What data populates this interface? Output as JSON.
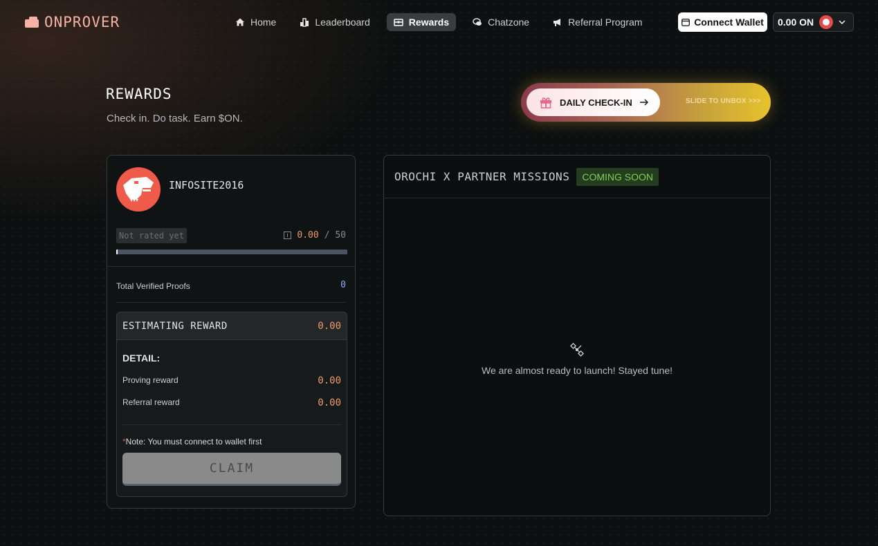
{
  "brand": {
    "name": "ONPROVER"
  },
  "nav": {
    "items": [
      {
        "label": "Home",
        "icon": "home-icon"
      },
      {
        "label": "Leaderboard",
        "icon": "leaderboard-icon"
      },
      {
        "label": "Rewards",
        "icon": "rewards-icon",
        "active": true
      },
      {
        "label": "Chatzone",
        "icon": "chat-icon"
      },
      {
        "label": "Referral Program",
        "icon": "megaphone-icon"
      }
    ],
    "connect_label": "Connect Wallet",
    "balance": "0.00 ON"
  },
  "header": {
    "title": "REWARDS",
    "subtitle": "Check in. Do task. Earn $ON."
  },
  "checkin": {
    "label": "DAILY CHECK-IN",
    "slide_text": "SLIDE TO UNBOX >>>"
  },
  "profile": {
    "username": "INFOSITE2016",
    "rating_label": "Not rated yet",
    "score": "0.00",
    "score_max": "/ 50",
    "progress_fraction": 0,
    "proofs_label": "Total Verified Proofs",
    "proofs_value": "0"
  },
  "reward": {
    "title": "ESTIMATING REWARD",
    "value": "0.00",
    "detail_title": "DETAIL:",
    "rows": [
      {
        "label": "Proving reward",
        "value": "0.00"
      },
      {
        "label": "Referral reward",
        "value": "0.00"
      }
    ],
    "note_star": "*",
    "note": "Note: You must connect to wallet first",
    "claim_label": "CLAIM"
  },
  "missions": {
    "title": "OROCHI X PARTNER MISSIONS",
    "badge": "COMING SOON",
    "empty_text": "We are almost ready to launch! Stayed tune!"
  }
}
